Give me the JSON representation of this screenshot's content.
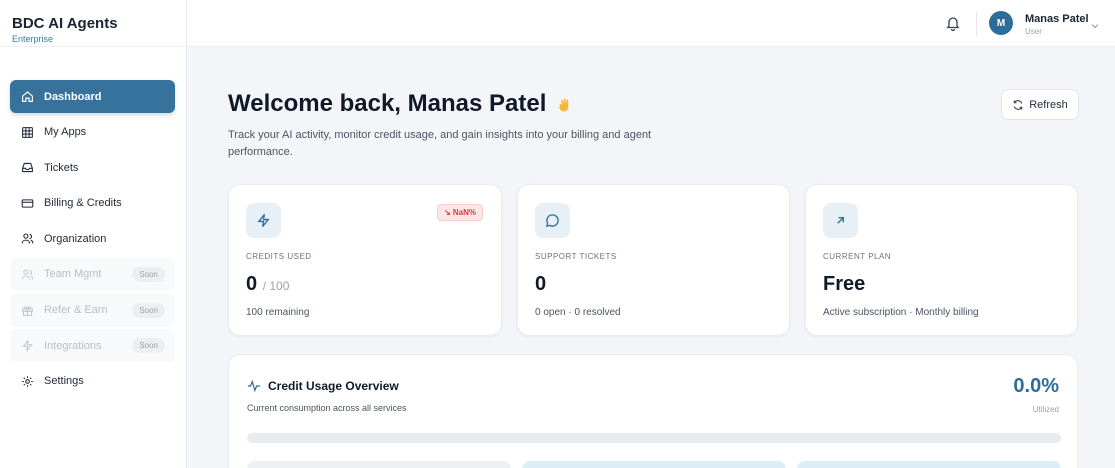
{
  "brand": {
    "title": "BDC AI Agents",
    "subtitle": "Enterprise"
  },
  "sidebar": {
    "items": [
      {
        "label": "Dashboard",
        "icon": "home-icon",
        "active": true
      },
      {
        "label": "My Apps",
        "icon": "grid-icon"
      },
      {
        "label": "Tickets",
        "icon": "inbox-icon"
      },
      {
        "label": "Billing & Credits",
        "icon": "credit-card-icon"
      },
      {
        "label": "Organization",
        "icon": "users-icon"
      },
      {
        "label": "Team Mgmt",
        "icon": "team-icon",
        "badge": "Soon",
        "disabled": true
      },
      {
        "label": "Refer & Earn",
        "icon": "gift-icon",
        "badge": "Soon",
        "disabled": true
      },
      {
        "label": "Integrations",
        "icon": "plug-icon",
        "badge": "Soon",
        "disabled": true
      },
      {
        "label": "Settings",
        "icon": "gear-icon"
      }
    ]
  },
  "topbar": {
    "avatar_initial": "M",
    "user_name": "Manas Patel",
    "user_role": "User"
  },
  "header": {
    "title": "Welcome back, Manas Patel",
    "subtitle": "Track your AI activity, monitor credit usage, and gain insights into your billing and agent performance.",
    "refresh_label": "Refresh"
  },
  "cards": {
    "credits": {
      "label": "CREDITS USED",
      "value": "0",
      "total": "/ 100",
      "foot": "100 remaining",
      "trend": "↘ NaN%"
    },
    "tickets": {
      "label": "SUPPORT TICKETS",
      "value": "0",
      "foot": "0 open · 0 resolved"
    },
    "plan": {
      "label": "CURRENT PLAN",
      "value": "Free",
      "foot": "Active subscription · Monthly billing"
    }
  },
  "overview": {
    "title": "Credit Usage Overview",
    "subtitle": "Current consumption across all services",
    "percent": "0.0%",
    "percent_label": "Utilized",
    "progress_fraction": 0
  },
  "colors": {
    "accent": "#36729b",
    "danger": "#d63b3b"
  }
}
